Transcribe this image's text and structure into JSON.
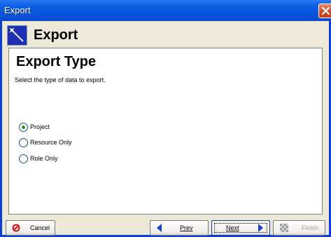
{
  "window": {
    "title": "Export"
  },
  "header": {
    "title": "Export"
  },
  "panel": {
    "title": "Export Type",
    "description": "Select the type of data to export.",
    "options": [
      {
        "label": "Project",
        "selected": true
      },
      {
        "label": "Resource Only",
        "selected": false
      },
      {
        "label": "Role Only",
        "selected": false
      }
    ]
  },
  "footer": {
    "cancel_label": "Cancel",
    "prev_label": "Prev",
    "next_label": "Next",
    "finish_label": "Finish",
    "finish_enabled": false
  },
  "colors": {
    "titlebar": "#0a53da",
    "accent_blue": "#1f3fd6",
    "cancel_red": "#d21010",
    "radio_selected": "#1fa11f"
  }
}
